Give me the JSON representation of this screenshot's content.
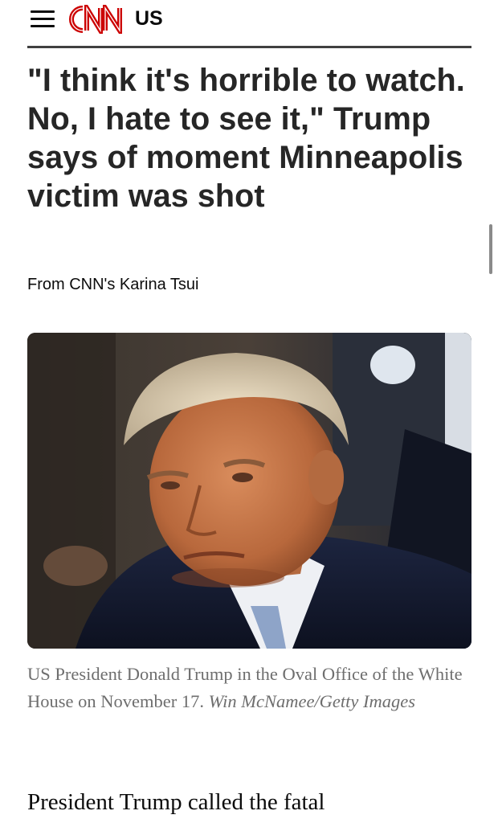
{
  "header": {
    "logo_text": "CNN",
    "edition": "US",
    "menu_icon": "hamburger-menu-icon",
    "logo_color": "#cc0000"
  },
  "article": {
    "headline": "\"I think it's horrible to watch. No, I hate to see it,\" Trump says of moment Minneapolis victim was shot",
    "byline": "From CNN's Karina Tsui",
    "image": {
      "caption": "US President Donald Trump in the Oval Office of the White House on November 17.",
      "credit": "Win McNamee/Getty Images"
    },
    "body_first_line": "President Trump called the fatal"
  }
}
